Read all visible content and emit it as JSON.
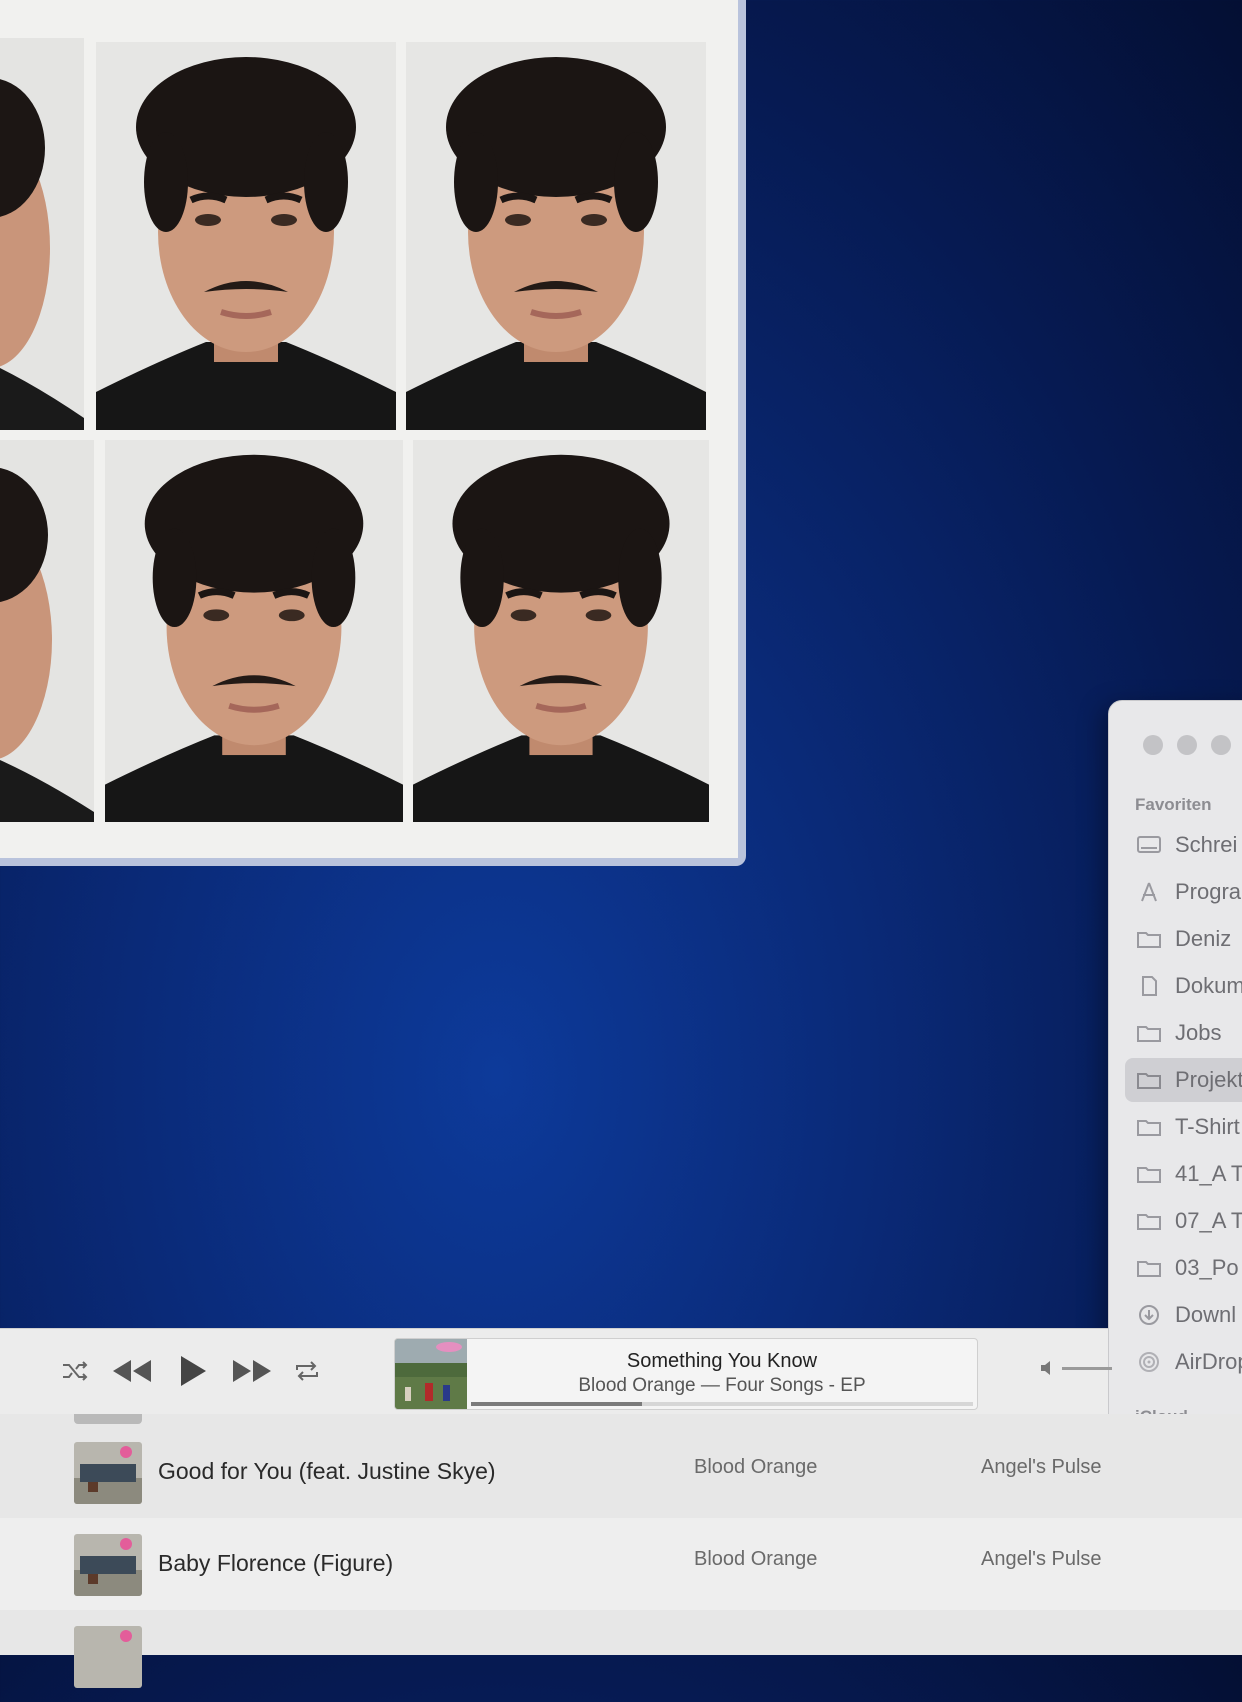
{
  "finder": {
    "section_favorites": "Favoriten",
    "section_icloud": "iCloud",
    "items": [
      {
        "label": "Schrei",
        "icon": "desktop-icon"
      },
      {
        "label": "Progra",
        "icon": "applications-icon"
      },
      {
        "label": "Deniz",
        "icon": "folder-icon"
      },
      {
        "label": "Dokum",
        "icon": "document-icon"
      },
      {
        "label": "Jobs",
        "icon": "folder-icon"
      },
      {
        "label": "Projekt",
        "icon": "folder-icon",
        "selected": true
      },
      {
        "label": "T-Shirt",
        "icon": "folder-icon"
      },
      {
        "label": "41_A T",
        "icon": "folder-icon"
      },
      {
        "label": "07_A T",
        "icon": "folder-icon"
      },
      {
        "label": "03_Po",
        "icon": "folder-icon"
      },
      {
        "label": "Downl",
        "icon": "download-icon"
      },
      {
        "label": "AirDrop",
        "icon": "airdrop-icon"
      }
    ]
  },
  "player": {
    "title": "Something You Know",
    "subtitle": "Blood Orange — Four Songs - EP",
    "progress": 0.34
  },
  "songs": [
    {
      "title": "Good for You (feat. Justine Skye)",
      "artist": "Blood Orange",
      "album": "Angel's Pulse"
    },
    {
      "title": "Baby Florence (Figure)",
      "artist": "Blood Orange",
      "album": "Angel's Pulse"
    }
  ],
  "colors": {
    "desktop": "#0a2a78",
    "finder_bg": "#e8e8ea",
    "player_bg": "#ececec"
  }
}
